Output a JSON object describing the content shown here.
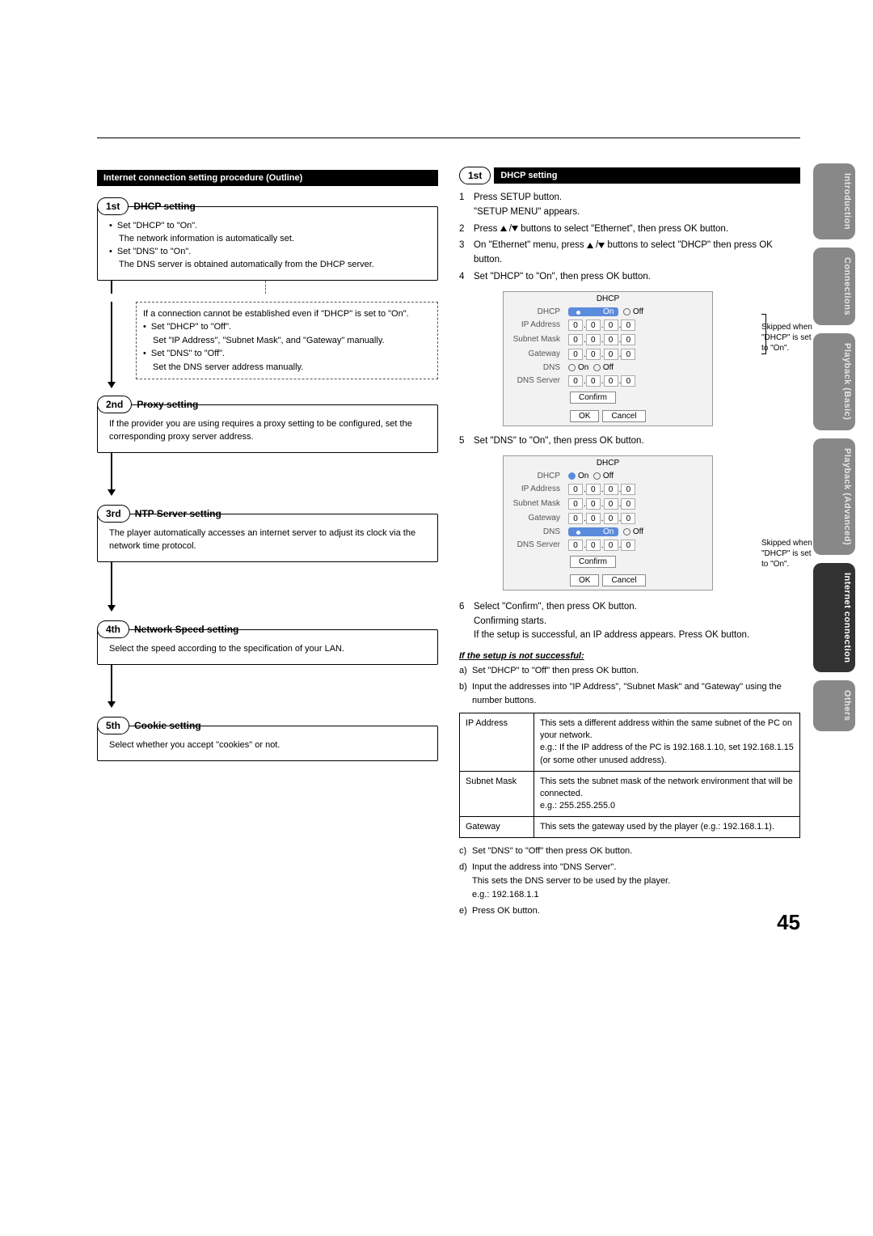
{
  "leftHeader": "Internet connection setting procedure (Outline)",
  "steps": {
    "s1": {
      "num": "1st",
      "title": "DHCP setting",
      "l1": "Set \"DHCP\" to \"On\".",
      "l2": "The network information is automatically set.",
      "l3": "Set \"DNS\" to \"On\".",
      "l4": "The DNS server is obtained automatically from the DHCP server."
    },
    "dash": {
      "l1": "If a connection cannot be established even if \"DHCP\" is set to \"On\".",
      "l2": "Set \"DHCP\" to \"Off\".",
      "l3": "Set \"IP Address\", \"Subnet Mask\", and \"Gateway\" manually.",
      "l4": "Set \"DNS\" to \"Off\".",
      "l5": "Set the DNS server address manually."
    },
    "s2": {
      "num": "2nd",
      "title": "Proxy setting",
      "body": "If the provider you are using requires a proxy setting to be configured, set the corresponding proxy server address."
    },
    "s3": {
      "num": "3rd",
      "title": "NTP Server setting",
      "body": "The player automatically accesses an internet server to adjust its clock via the network time protocol."
    },
    "s4": {
      "num": "4th",
      "title": "Network Speed setting",
      "body": "Select the speed according to the specification of your LAN."
    },
    "s5": {
      "num": "5th",
      "title": "Cookie setting",
      "body": "Select whether you accept \"cookies\" or not."
    }
  },
  "right": {
    "s1title": "DHCP setting",
    "o1": "Press SETUP button.",
    "o1b": "\"SETUP MENU\" appears.",
    "o2a": "Press ",
    "o2b": " buttons to select \"Ethernet\", then press OK button.",
    "o3a": "On \"Ethernet\" menu, press ",
    "o3b": " buttons to select \"DHCP\" then press OK button.",
    "o4": "Set \"DHCP\" to \"On\", then press OK button.",
    "o5": "Set \"DNS\" to \"On\", then press OK button.",
    "o6a": "Select \"Confirm\", then press OK button.",
    "o6b": "Confirming starts.",
    "o6c": "If the setup is successful, an IP address appears. Press OK button.",
    "unsucc": "If the setup is not successful:",
    "la": "Set \"DHCP\" to \"Off\" then press OK button.",
    "lb": "Input the addresses into \"IP Address\", \"Subnet Mask\" and \"Gateway\" using the number buttons.",
    "lc": "Set \"DNS\" to \"Off\" then press OK button.",
    "ld": "Input the address into \"DNS Server\".",
    "ld2": "This sets the DNS server to be used by the player.",
    "ld3": "e.g.: 192.168.1.1",
    "le": "Press OK button.",
    "skip": "Skipped when \"DHCP\" is set to \"On\"."
  },
  "menu": {
    "title": "DHCP",
    "rows": {
      "dhcp": "DHCP",
      "ip": "IP Address",
      "sm": "Subnet Mask",
      "gw": "Gateway",
      "dns": "DNS",
      "dnss": "DNS Server"
    },
    "on": "On",
    "off": "Off",
    "zero": "0",
    "confirm": "Confirm",
    "ok": "OK",
    "cancel": "Cancel"
  },
  "addr": {
    "ipk": "IP Address",
    "ipv": "This sets a different address within the same subnet of the PC on your network.\ne.g.: If the IP address of the PC is 192.168.1.10, set 192.168.1.15 (or some other unused address).",
    "smk": "Subnet Mask",
    "smv": "This sets the subnet mask of the network environment that will be connected.\ne.g.: 255.255.255.0",
    "gwk": "Gateway",
    "gwv": "This sets the gateway used by the player (e.g.: 192.168.1.1)."
  },
  "tabs": [
    "Introduction",
    "Connections",
    "Playback (Basic)",
    "Playback (Advanced)",
    "Internet connection",
    "Others"
  ],
  "pageNum": "45"
}
